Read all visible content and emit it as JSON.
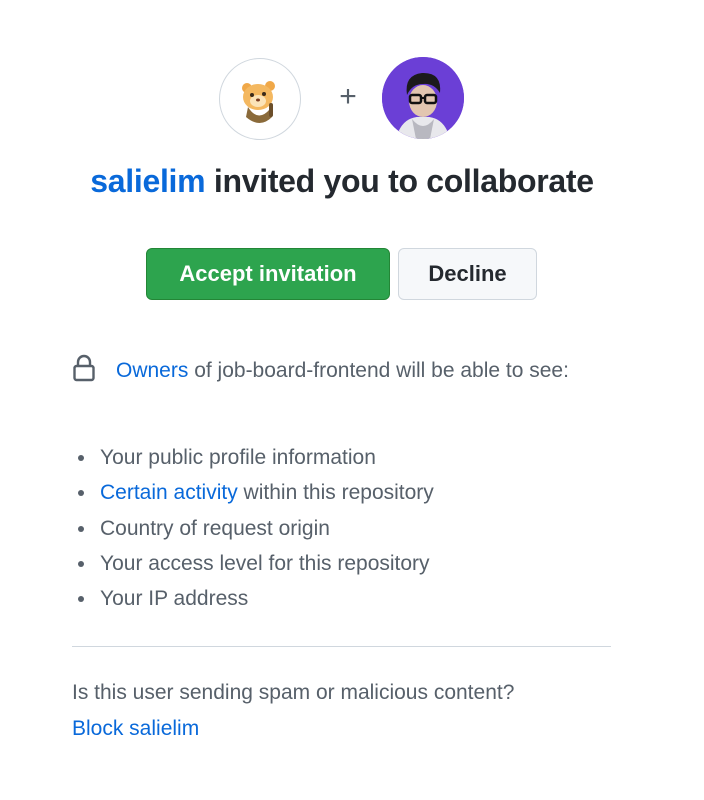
{
  "invite": {
    "inviter": "salielim",
    "plus_symbol": "+",
    "title_rest": " invited you to collaborate",
    "inviter_avatar_icon": "inviter-avatar-illustration",
    "user_avatar_icon": "user-avatar-photo"
  },
  "actions": {
    "accept_label": "Accept invitation",
    "decline_label": "Decline"
  },
  "notice": {
    "lock_icon": "lock-icon",
    "owners_link": "Owners",
    "text": " of job-board-frontend will be able to see:"
  },
  "permissions": {
    "item0": "Your public profile information",
    "item1_link": "Certain activity",
    "item1_rest": " within this repository",
    "item2": "Country of request origin",
    "item3": "Your access level for this repository",
    "item4": "Your IP address"
  },
  "spam": {
    "question": "Is this user sending spam or malicious content?",
    "block_link": "Block salielim"
  },
  "colors": {
    "accent_link": "#0969da",
    "accept_green": "#2da44e",
    "text_primary": "#24292f",
    "text_muted": "#57606a",
    "user_avatar_bg": "#6b3fd6"
  }
}
